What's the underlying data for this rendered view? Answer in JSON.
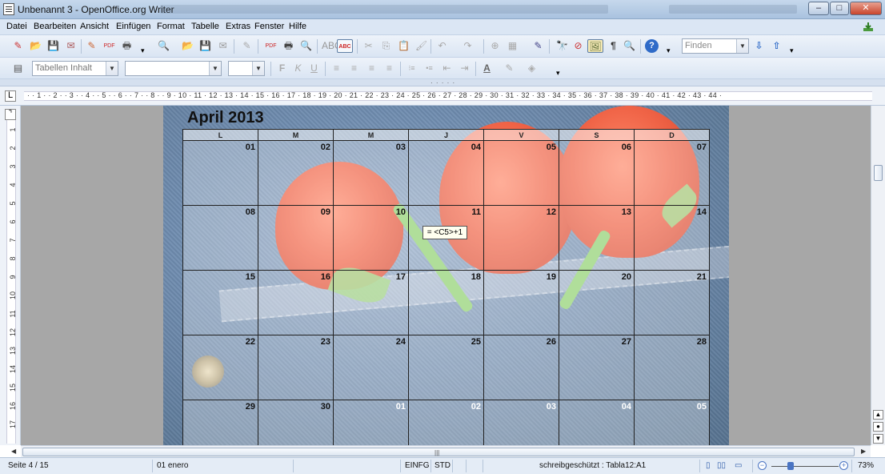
{
  "window": {
    "title": "Unbenannt 3 - OpenOffice.org Writer",
    "controls": {
      "minimize": "–",
      "maximize": "□",
      "close": "✕"
    }
  },
  "menu": {
    "items": [
      "Datei",
      "Bearbeiten",
      "Ansicht",
      "Einfügen",
      "Format",
      "Tabelle",
      "Extras",
      "Fenster",
      "Hilfe"
    ]
  },
  "toolbar": {
    "find_placeholder": "Finden",
    "icons": {
      "new": "✎",
      "open": "📂",
      "save": "💾",
      "mail": "✉",
      "edit": "✎",
      "pdf": "PDF",
      "print": "🖶",
      "preview": "🔍",
      "spell": "ABC",
      "cut": "✂",
      "copy": "⎘",
      "paste": "📋",
      "brush": "🖌",
      "undo": "↶",
      "redo": "↷",
      "hyperlink": "⊕",
      "table": "▦",
      "draw": "✎",
      "find": "🔭",
      "navigator": "⊘",
      "gallery": "🖼",
      "nonprint": "¶",
      "zoom": "🔍",
      "help": "?",
      "find_next": "⇩",
      "find_prev": "⇧"
    }
  },
  "format_bar": {
    "style_value": "Tabellen Inhalt",
    "font_value": "",
    "size_value": "",
    "icons": {
      "bold": "F",
      "italic": "K",
      "underline": "U",
      "align_left": "≡",
      "center": "≡",
      "right": "≡",
      "justify": "≡",
      "num_list": "⁝≡",
      "bul_list": "•≡",
      "dec_indent": "⇤",
      "inc_indent": "⇥",
      "font_color": "A",
      "highlight": "✎",
      "bg_color": "◈"
    }
  },
  "ruler": {
    "horizontal": "· · 1 · · 2 · · 3 · · 4 · · 5 · · 6 · · 7 · · 8 · · 9 · 10 · 11 · 12 · 13 · 14 · 15 · 16 · 17 · 18 · 19 · 20 · 21 · 22 · 23 · 24 · 25 · 26 · 27 · 28 · 29 · 30 · 31 · 32 · 33 · 34 · 35 · 36 · 37 · 38 · 39 · 40 · 41 · 42 · 43 · 44 ·",
    "vertical": [
      "1",
      "2",
      "3",
      "4",
      "5",
      "6",
      "7",
      "8",
      "9",
      "10",
      "11",
      "12",
      "13",
      "14",
      "15",
      "16",
      "17"
    ]
  },
  "document": {
    "calendar_title": "April 2013",
    "weekdays": [
      "L",
      "M",
      "M",
      "J",
      "V",
      "S",
      "D"
    ],
    "weeks": [
      [
        "01",
        "02",
        "03",
        "04",
        "05",
        "06",
        "07"
      ],
      [
        "08",
        "09",
        "10",
        "11",
        "12",
        "13",
        "14"
      ],
      [
        "15",
        "16",
        "17",
        "18",
        "19",
        "20",
        "21"
      ],
      [
        "22",
        "23",
        "24",
        "25",
        "26",
        "27",
        "28"
      ],
      [
        "29",
        "30",
        "01",
        "02",
        "03",
        "04",
        "05"
      ]
    ],
    "formula_tooltip": "= <C5>+1"
  },
  "statusbar": {
    "page": "Seite 4 / 15",
    "style": "01 enero",
    "insert_mode": "EINFG",
    "selection_mode": "STD",
    "protection": "schreibgeschützt : Tabla12:A1",
    "zoom": "73%"
  }
}
